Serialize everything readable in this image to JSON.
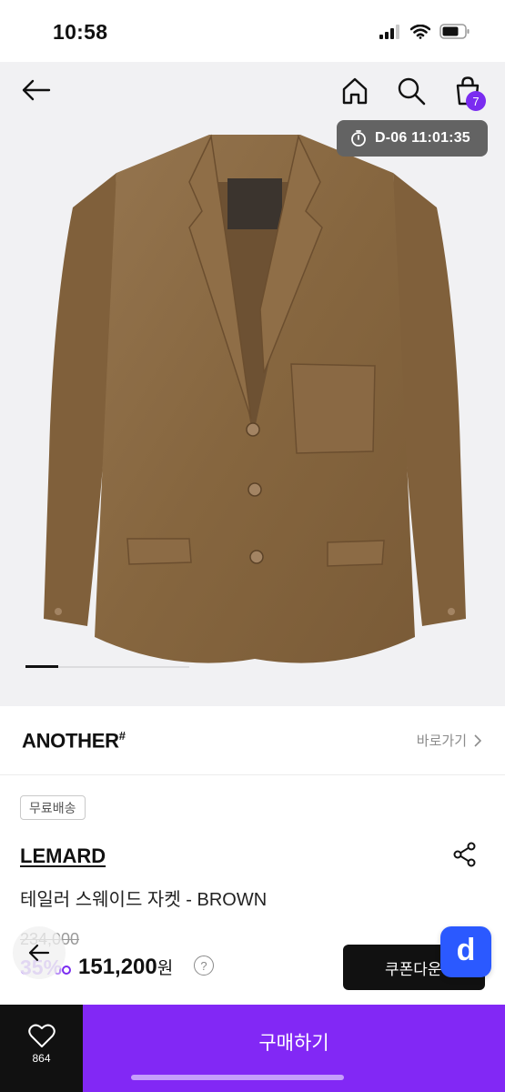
{
  "status_bar": {
    "time": "10:58"
  },
  "header": {
    "cart_count": "7"
  },
  "timer": {
    "label": "D-06 11:01:35"
  },
  "gallery": {
    "current_index": 1,
    "total": 5,
    "image_subject": "brown suede tailored jacket"
  },
  "brand": {
    "name": "ANOTHER",
    "name_mark": "#",
    "link_label": "바로가기"
  },
  "product": {
    "shipping_badge": "무료배송",
    "brand": "LEMARD",
    "name": "테일러 스웨이드 자켓 - BROWN",
    "original_price": "234,000",
    "discount": "35%",
    "sale_price": "151,200",
    "currency_unit": "원"
  },
  "actions": {
    "coupon_label": "쿠폰다운",
    "like_count": "864",
    "buy_label": "구매하기",
    "floating_app_letter": "d"
  },
  "colors": {
    "accent": "#8228f5",
    "badge": "#7a2cf0",
    "app_button": "#2b59ff",
    "jacket": "#8a6a47"
  },
  "icons": [
    "back-arrow-icon",
    "home-icon",
    "search-icon",
    "cart-icon",
    "stopwatch-icon",
    "chevron-right-icon",
    "share-icon",
    "help-icon",
    "heart-icon"
  ]
}
